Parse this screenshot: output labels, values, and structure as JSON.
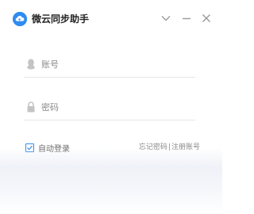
{
  "app": {
    "title": "微云同步助手",
    "logo_icon": "cloud-logo-icon",
    "accent_color": "#2f8cf0"
  },
  "titlebar": {
    "collapse_icon": "chevron-down-icon",
    "minimize_icon": "minimize-icon",
    "close_icon": "close-icon"
  },
  "form": {
    "account": {
      "placeholder": "账号",
      "value": "",
      "icon": "user-icon"
    },
    "password": {
      "placeholder": "密码",
      "value": "",
      "icon": "lock-icon"
    },
    "auto_login": {
      "label": "自动登录",
      "checked": true
    },
    "forgot_password_label": "忘记密码",
    "separator": "|",
    "register_label": "注册账号"
  }
}
